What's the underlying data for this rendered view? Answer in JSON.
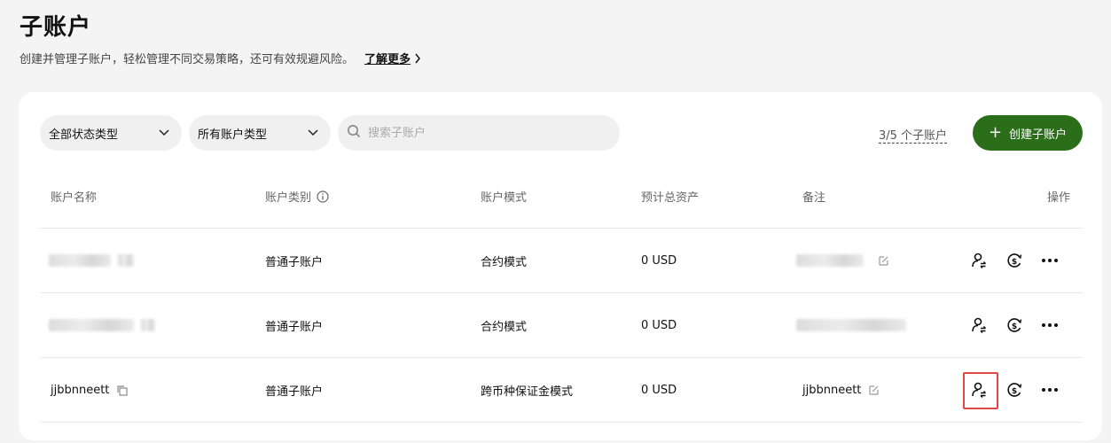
{
  "header": {
    "title": "子账户",
    "subtitle": "创建并管理子账户，轻松管理不同交易策略，还可有效规避风险。",
    "learn_more": "了解更多"
  },
  "filters": {
    "status_type": "全部状态类型",
    "account_type": "所有账户类型",
    "search_placeholder": "搜索子账户",
    "count": "3/5 个子账户",
    "create_button": "创建子账户"
  },
  "table": {
    "headers": {
      "name": "账户名称",
      "category": "账户类别",
      "mode": "账户模式",
      "assets": "预计总资产",
      "note": "备注",
      "actions": "操作"
    },
    "rows": [
      {
        "name": "",
        "category": "普通子账户",
        "mode": "合约模式",
        "assets": "0 USD",
        "note": ""
      },
      {
        "name": "",
        "category": "普通子账户",
        "mode": "合约模式",
        "assets": "0 USD",
        "note": ""
      },
      {
        "name": "jjbbnneett",
        "category": "普通子账户",
        "mode": "跨币种保证金模式",
        "assets": "0 USD",
        "note": "jjbbnneett"
      }
    ]
  },
  "colors": {
    "accent": "#2a6e1a",
    "highlight": "#e04848"
  }
}
